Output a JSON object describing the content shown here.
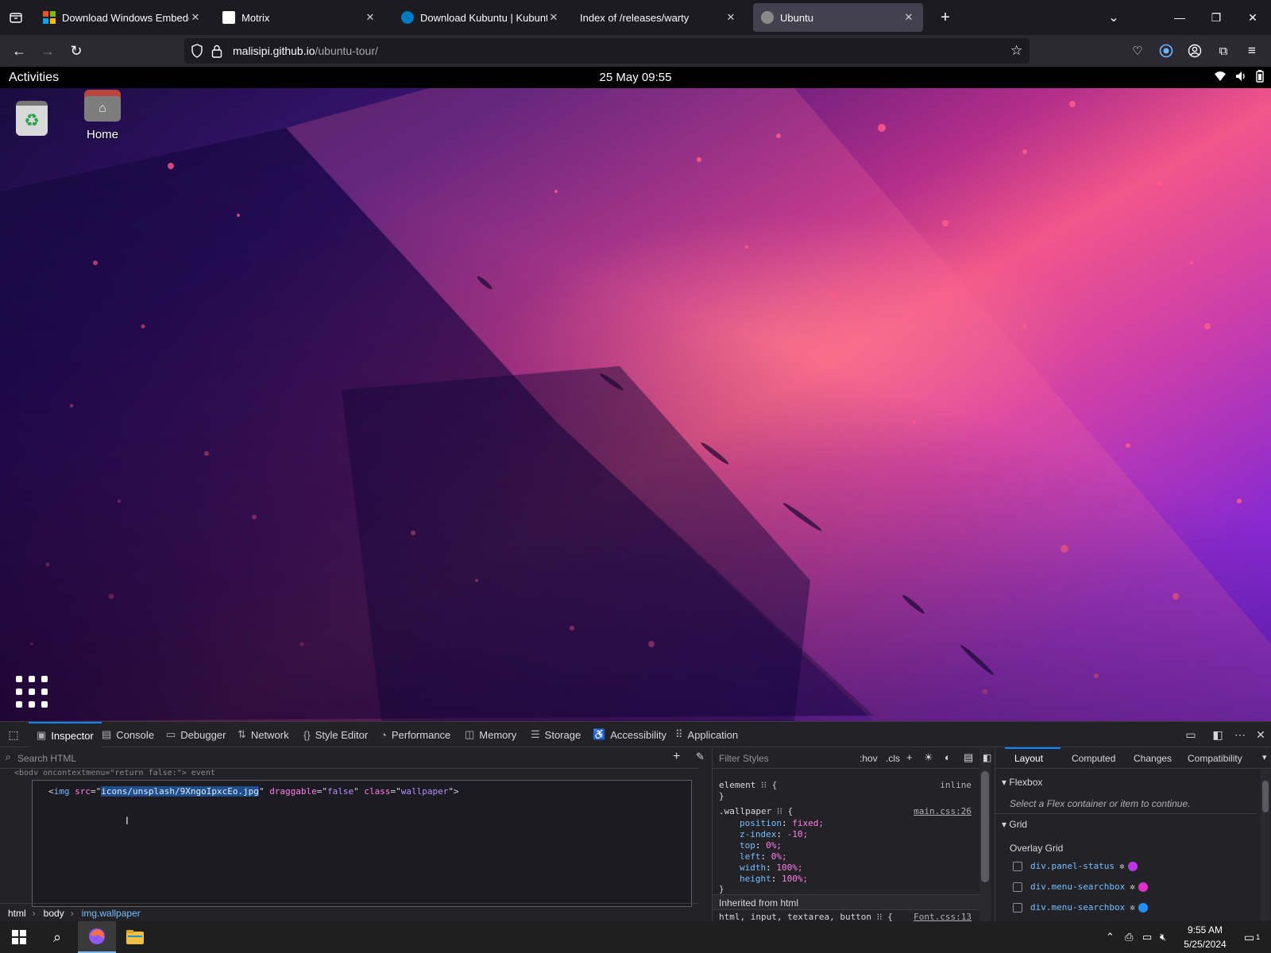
{
  "browser": {
    "tabs": [
      {
        "title": "Download Windows Embedded Compact",
        "favicon_color": "#f25022"
      },
      {
        "title": "Motrix",
        "favicon_color": "#ffffff"
      },
      {
        "title": "Download Kubuntu | Kubuntu",
        "favicon_color": "#0079c1"
      },
      {
        "title": "Index of /releases/warty",
        "favicon_color": ""
      },
      {
        "title": "Ubuntu",
        "favicon_color": "#8a8a8a"
      }
    ],
    "url_host": "malisipi.github.io",
    "url_path": "/ubuntu-tour/"
  },
  "gnome": {
    "activities": "Activities",
    "clock": "25 May 09:55"
  },
  "desktop": {
    "home_label": "Home"
  },
  "devtools": {
    "tabs": [
      "Inspector",
      "Console",
      "Debugger",
      "Network",
      "Style Editor",
      "Performance",
      "Memory",
      "Storage",
      "Accessibility",
      "Application"
    ],
    "search_placeholder": "Search HTML",
    "prev_line": "<body oncontextmenu=\"return false;\"> event",
    "markup": {
      "tag": "img",
      "src_attr": "src",
      "src_val": "icons/unsplash/9XngoIpxcEo.jpg",
      "draggable_attr": "draggable",
      "draggable_val": "false",
      "class_attr": "class",
      "class_val": "wallpaper"
    },
    "breadcrumbs": [
      "html",
      "body",
      "img.wallpaper"
    ],
    "rules": {
      "filter_placeholder": "Filter Styles",
      "hov": ":hov",
      "cls": ".cls",
      "element_selector": "element ⁝⁝ {",
      "element_close": "}",
      "inline": "inline",
      "wallpaper_selector": ".wallpaper ⁝⁝ {",
      "wallpaper_source": "main.css:26",
      "declarations": [
        {
          "prop": "position",
          "val": "fixed;"
        },
        {
          "prop": "z-index",
          "val": "-10;"
        },
        {
          "prop": "top",
          "val": "0%;"
        },
        {
          "prop": "left",
          "val": "0%;"
        },
        {
          "prop": "width",
          "val": "100%;"
        },
        {
          "prop": "height",
          "val": "100%;"
        }
      ],
      "wallpaper_close": "}",
      "inherited_label": "Inherited from html",
      "html_selector": "html, input, textarea, button ⁝⁝ {",
      "html_source": "Font.css:13"
    },
    "layout": {
      "tabs": [
        "Layout",
        "Computed",
        "Changes",
        "Compatibility"
      ],
      "flexbox_title": "Flexbox",
      "flexbox_msg": "Select a Flex container or item to continue.",
      "grid_title": "Grid",
      "overlay_title": "Overlay Grid",
      "grid_items": [
        {
          "name": "div.panel-status",
          "color": "#b936e6"
        },
        {
          "name": "div.menu-searchbox",
          "color": "#e02ec6"
        },
        {
          "name": "div.menu-searchbox",
          "color": "#1e90ff"
        }
      ]
    }
  },
  "taskbar": {
    "time": "9:55 AM",
    "date": "5/25/2024",
    "notification_count": "1"
  }
}
